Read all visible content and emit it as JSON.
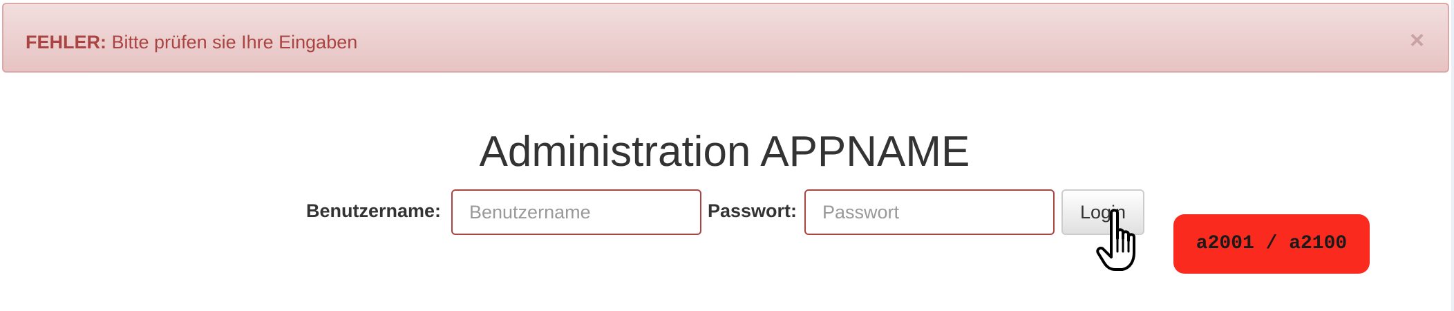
{
  "alert": {
    "label": "FEHLER:",
    "message": "Bitte prüfen sie Ihre Eingaben",
    "close_symbol": "×"
  },
  "page": {
    "title": "Administration APPNAME"
  },
  "login_form": {
    "username_label": "Benutzername:",
    "username_placeholder": "Benutzername",
    "username_value": "",
    "password_label": "Passwort:",
    "password_placeholder": "Passwort",
    "password_value": "",
    "submit_label": "Login"
  },
  "annotation": {
    "badge_text": "a2001 / a2100",
    "badge_color": "#fb2a1e",
    "cursor_icon": "hand-pointer-icon"
  },
  "colors": {
    "error_text": "#a94442",
    "error_background": "#f2dede",
    "error_border": "#dca7a7"
  }
}
